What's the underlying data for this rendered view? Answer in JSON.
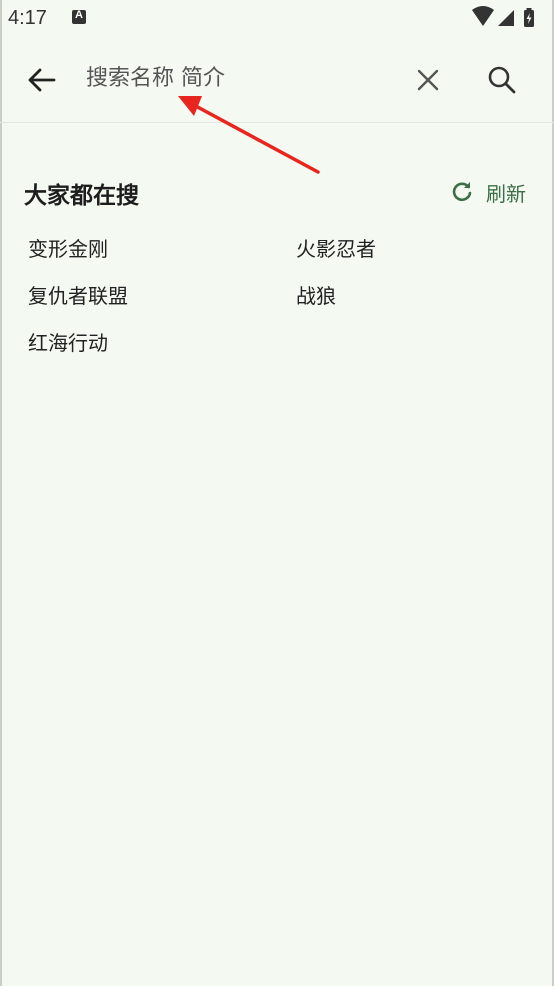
{
  "status_bar": {
    "time": "4:17",
    "notification_icon": "a-icon",
    "icons": [
      "wifi-icon",
      "signal-icon",
      "battery-charging-icon"
    ]
  },
  "search": {
    "placeholder": "搜索名称 简介",
    "back_icon": "arrow-left-icon",
    "clear_icon": "close-icon",
    "search_icon": "search-icon"
  },
  "hot": {
    "title": "大家都在搜",
    "refresh_label": "刷新",
    "refresh_icon": "refresh-icon",
    "items": [
      "变形金刚",
      "火影忍者",
      "复仇者联盟",
      "战狼",
      "红海行动"
    ]
  },
  "colors": {
    "background": "#f4f9f1",
    "accent": "#3c6e47",
    "annotation": "#e8261f"
  }
}
